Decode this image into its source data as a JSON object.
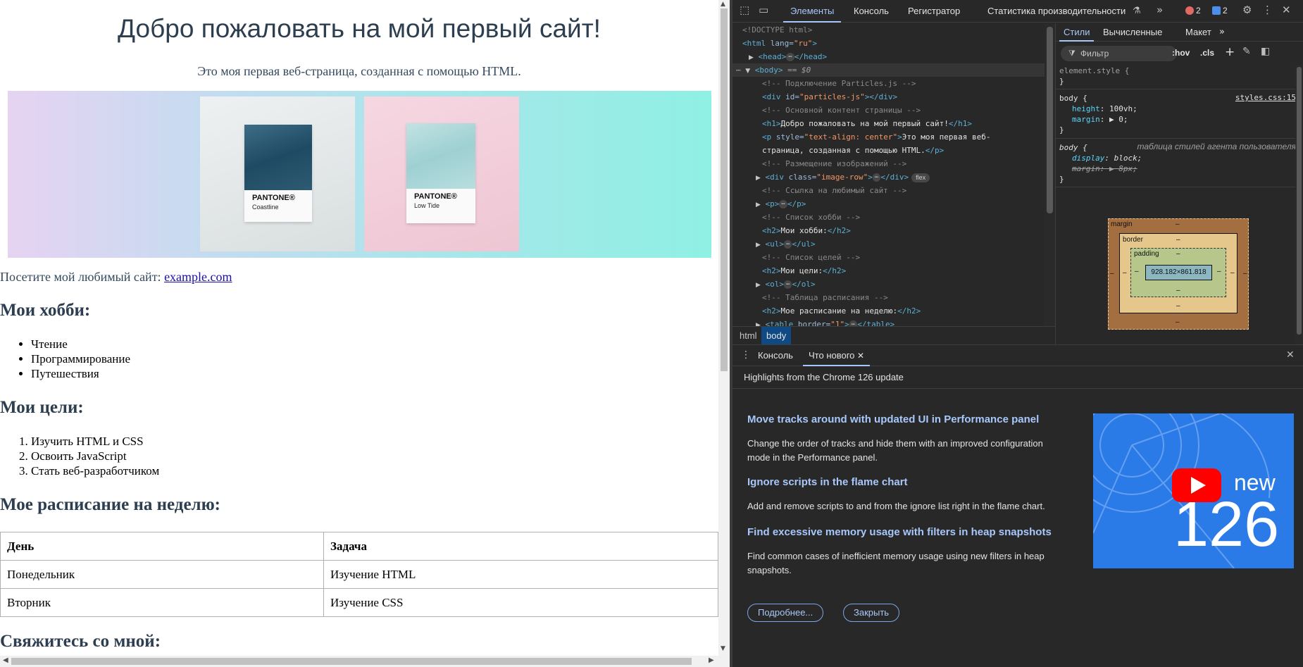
{
  "site": {
    "h1": "Добро пожаловать на мой первый сайт!",
    "intro": "Это моя первая веб-страница, созданная с помощью HTML.",
    "images": [
      {
        "brand": "PANTONE®",
        "name": "Coastline"
      },
      {
        "brand": "PANTONE®",
        "name": "Low Tide"
      }
    ],
    "fav_prefix": "Посетите мой любимый сайт: ",
    "fav_link": "example.com",
    "hobbies_title": "Мои хобби:",
    "hobbies": [
      "Чтение",
      "Программирование",
      "Путешествия"
    ],
    "goals_title": "Мои цели:",
    "goals": [
      "Изучить HTML и CSS",
      "Освоить JavaScript",
      "Стать веб-разработчиком"
    ],
    "schedule_title": "Мое расписание на неделю:",
    "schedule_headers": [
      "День",
      "Задача"
    ],
    "schedule_rows": [
      [
        "Понедельник",
        "Изучение HTML"
      ],
      [
        "Вторник",
        "Изучение CSS"
      ]
    ],
    "contact_title": "Свяжитесь со мной:"
  },
  "devtools": {
    "tabs": [
      "Элементы",
      "Консоль",
      "Регистратор",
      "Статистика производительности"
    ],
    "errors_count": "2",
    "messages_count": "2",
    "tree": {
      "doctype": "<!DOCTYPE html>",
      "html_tag": "html",
      "lang_attr": "lang",
      "lang_val": "\"ru\"",
      "head": "head",
      "body": "body",
      "body_suffix": " == $0",
      "c1": "<!-- Подключение Particles.js -->",
      "particles_id": "\"particles-js\"",
      "c2": "<!-- Основной контент страницы -->",
      "h1_text": "Добро пожаловать на мой первый сайт!",
      "p_style": "\"text-align: center\"",
      "p_text1": "Это моя первая веб-",
      "p_text2": "страница, созданная с помощью HTML.",
      "c3": "<!-- Размещение изображений -->",
      "image_row_class": "\"image-row\"",
      "flex": "flex",
      "c4": "<!-- Ссылка на любимый сайт -->",
      "c5": "<!-- Список хобби -->",
      "h2_hobbies": "Мои хобби:",
      "c6": "<!-- Список целей -->",
      "h2_goals": "Мои цели:",
      "c7": "<!-- Таблица расписания -->",
      "h2_schedule": "Мое расписание на неделю:",
      "table_border": "\"1\""
    },
    "breadcrumbs": [
      "html",
      "body"
    ],
    "styles_tabs": [
      "Стили",
      "Вычисленные",
      "Макет"
    ],
    "filter_placeholder": "Фильтр",
    "hov": ":hov",
    "cls": ".cls",
    "element_style": "element.style {",
    "rule1": {
      "selector": "body {",
      "source": "styles.css:15",
      "p1": "height",
      "v1": "100vh",
      "p2": "margin",
      "v2": "0"
    },
    "rule2": {
      "selector": "body {",
      "source": "таблица стилей агента пользователя",
      "p1": "display",
      "v1": "block",
      "p2": "margin",
      "v2": "8px"
    },
    "box_model": {
      "margin": "margin",
      "border": "border",
      "padding": "padding",
      "content": "928.182×861.818",
      "dash": "–"
    },
    "drawer_tabs": [
      "Консоль",
      "Что нового"
    ],
    "whats_new": {
      "header": "Highlights from the Chrome 126 update",
      "items": [
        {
          "title": "Move tracks around with updated UI in Performance panel",
          "desc": "Change the order of tracks and hide them with an improved configuration mode in the Performance panel."
        },
        {
          "title": "Ignore scripts in the flame chart",
          "desc": "Add and remove scripts to and from the ignore list right in the flame chart."
        },
        {
          "title": "Find excessive memory usage with filters in heap snapshots",
          "desc": "Find common cases of inefficient memory usage using new filters in heap snapshots."
        }
      ],
      "learn_more": "Подробнее...",
      "close": "Закрыть",
      "promo_new": "new",
      "promo_version": "126"
    }
  }
}
